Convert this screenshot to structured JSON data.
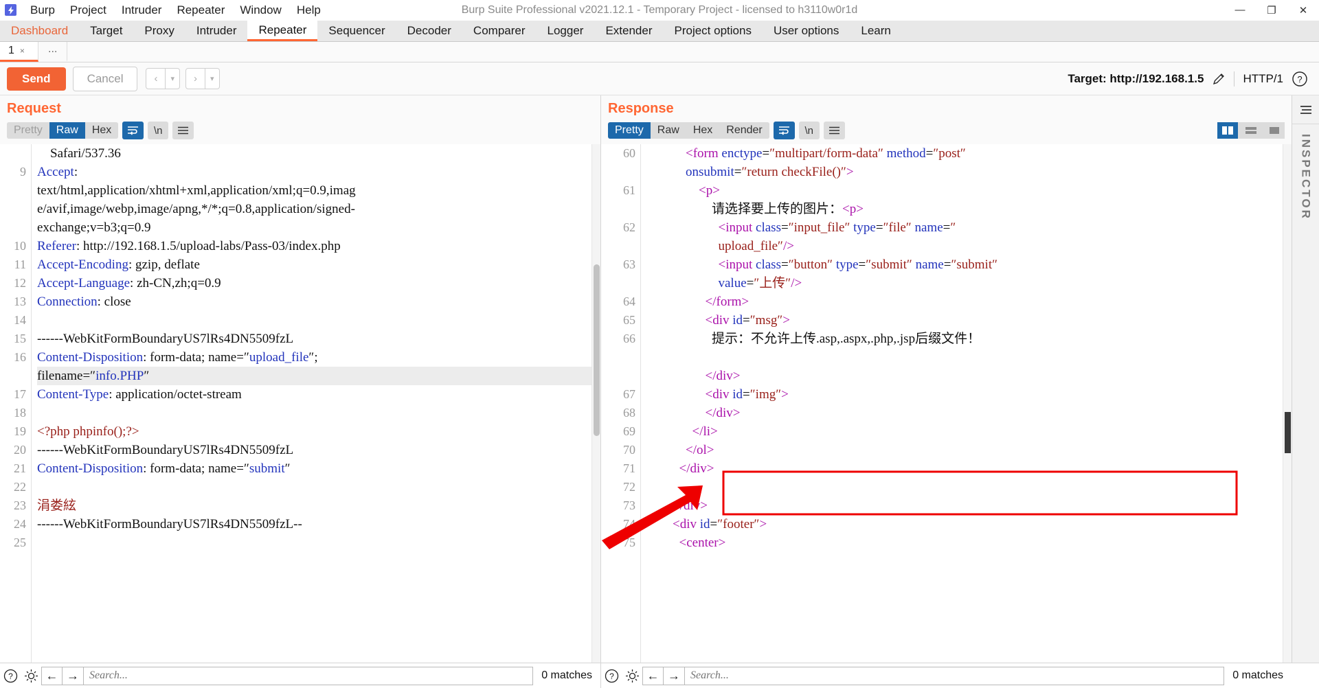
{
  "window": {
    "title": "Burp Suite Professional v2021.12.1 - Temporary Project - licensed to h3110w0r1d",
    "logo_glyph": "⚡",
    "minimize": "—",
    "maximize": "❐",
    "close": "✕"
  },
  "menubar": {
    "items": [
      "Burp",
      "Project",
      "Intruder",
      "Repeater",
      "Window",
      "Help"
    ]
  },
  "main_tabs": {
    "items": [
      "Dashboard",
      "Target",
      "Proxy",
      "Intruder",
      "Repeater",
      "Sequencer",
      "Decoder",
      "Comparer",
      "Logger",
      "Extender",
      "Project options",
      "User options",
      "Learn"
    ],
    "active": "Repeater",
    "accent": "#ff6633"
  },
  "repeater_tabs": {
    "items": [
      {
        "label": "1",
        "close": "×"
      }
    ],
    "add_label": "..."
  },
  "toolbar": {
    "send_label": "Send",
    "cancel_label": "Cancel",
    "back_arrow": "‹",
    "forward_arrow": "›",
    "dropdown_caret": "▾",
    "target_label": "Target: http://192.168.1.5",
    "edit_icon": "pencil-icon",
    "http_version": "HTTP/1",
    "help_icon": "?"
  },
  "request": {
    "title": "Request",
    "view_buttons": [
      "Pretty",
      "Raw",
      "Hex"
    ],
    "active_view": "Raw",
    "disabled_view": "Pretty",
    "wrap_icon_on": true,
    "newline_label": "\\n",
    "menu_icon": "☰",
    "lines": [
      {
        "num": "",
        "segs": [
          {
            "t": "    Safari/537.36",
            "c": "k-black"
          }
        ]
      },
      {
        "num": "9",
        "segs": [
          {
            "t": "Accept",
            "c": "k-blue"
          },
          {
            "t": ":",
            "c": "k-black"
          }
        ]
      },
      {
        "num": "",
        "segs": [
          {
            "t": "text/html,application/xhtml+xml,application/xml;q=0.9,imag",
            "c": "k-black"
          }
        ]
      },
      {
        "num": "",
        "segs": [
          {
            "t": "e/avif,image/webp,image/apng,*/*;q=0.8,application/signed-",
            "c": "k-black"
          }
        ]
      },
      {
        "num": "",
        "segs": [
          {
            "t": "exchange;v=b3;q=0.9",
            "c": "k-black"
          }
        ]
      },
      {
        "num": "10",
        "segs": [
          {
            "t": "Referer",
            "c": "k-blue"
          },
          {
            "t": ": http://192.168.1.5/upload-labs/Pass-03/index.php",
            "c": "k-black"
          }
        ]
      },
      {
        "num": "11",
        "segs": [
          {
            "t": "Accept-Encoding",
            "c": "k-blue"
          },
          {
            "t": ": gzip, deflate",
            "c": "k-black"
          }
        ]
      },
      {
        "num": "12",
        "segs": [
          {
            "t": "Accept-Language",
            "c": "k-blue"
          },
          {
            "t": ": zh-CN,zh;q=0.9",
            "c": "k-black"
          }
        ]
      },
      {
        "num": "13",
        "segs": [
          {
            "t": "Connection",
            "c": "k-blue"
          },
          {
            "t": ": close",
            "c": "k-black"
          }
        ]
      },
      {
        "num": "14",
        "segs": [
          {
            "t": "",
            "c": "k-black"
          }
        ]
      },
      {
        "num": "15",
        "segs": [
          {
            "t": "------WebKitFormBoundaryUS7lRs4DN5509fzL",
            "c": "k-black"
          }
        ]
      },
      {
        "num": "16",
        "segs": [
          {
            "t": "Content-Disposition",
            "c": "k-blue"
          },
          {
            "t": ": form-data; name=″",
            "c": "k-black"
          },
          {
            "t": "upload_file",
            "c": "k-blue"
          },
          {
            "t": "″;",
            "c": "k-black"
          }
        ]
      },
      {
        "num": "",
        "hl": true,
        "segs": [
          {
            "t": "filename=″",
            "c": "k-black"
          },
          {
            "t": "info.PHP",
            "c": "k-blue"
          },
          {
            "t": "″",
            "c": "k-black"
          }
        ]
      },
      {
        "num": "17",
        "segs": [
          {
            "t": "Content-Type",
            "c": "k-blue"
          },
          {
            "t": ": application/octet-stream",
            "c": "k-black"
          }
        ]
      },
      {
        "num": "18",
        "segs": [
          {
            "t": "",
            "c": "k-black"
          }
        ]
      },
      {
        "num": "19",
        "segs": [
          {
            "t": "<?php phpinfo();?>",
            "c": "k-darkred"
          }
        ]
      },
      {
        "num": "20",
        "segs": [
          {
            "t": "------WebKitFormBoundaryUS7lRs4DN5509fzL",
            "c": "k-black"
          }
        ]
      },
      {
        "num": "21",
        "segs": [
          {
            "t": "Content-Disposition",
            "c": "k-blue"
          },
          {
            "t": ": form-data; name=″",
            "c": "k-black"
          },
          {
            "t": "submit",
            "c": "k-blue"
          },
          {
            "t": "″",
            "c": "k-black"
          }
        ]
      },
      {
        "num": "22",
        "segs": [
          {
            "t": "",
            "c": "k-black"
          }
        ]
      },
      {
        "num": "23",
        "segs": [
          {
            "t": "涓娄絃",
            "c": "k-darkred"
          }
        ]
      },
      {
        "num": "24",
        "segs": [
          {
            "t": "------WebKitFormBoundaryUS7lRs4DN5509fzL--",
            "c": "k-black"
          }
        ]
      },
      {
        "num": "25",
        "segs": [
          {
            "t": "",
            "c": "k-black"
          }
        ]
      }
    ]
  },
  "response": {
    "title": "Response",
    "view_buttons": [
      "Pretty",
      "Raw",
      "Hex",
      "Render"
    ],
    "active_view": "Pretty",
    "wrap_icon_on": true,
    "newline_label": "\\n",
    "menu_icon": "☰",
    "layout_modes": [
      "split-vertical",
      "split-horizontal",
      "single"
    ],
    "active_layout": "split-vertical",
    "lines": [
      {
        "num": "60",
        "indent": 6,
        "segs": [
          {
            "t": "<",
            "c": "k-purple"
          },
          {
            "t": "form",
            "c": "k-purple"
          },
          {
            "t": " ",
            "c": "k-black"
          },
          {
            "t": "enctype",
            "c": "k-blue"
          },
          {
            "t": "=",
            "c": "k-black"
          },
          {
            "t": "″multipart/form-data″",
            "c": "k-darkred"
          },
          {
            "t": " ",
            "c": "k-black"
          },
          {
            "t": "method",
            "c": "k-blue"
          },
          {
            "t": "=",
            "c": "k-black"
          },
          {
            "t": "″post″",
            "c": "k-darkred"
          }
        ]
      },
      {
        "num": "",
        "indent": 6,
        "segs": [
          {
            "t": "onsubmit",
            "c": "k-blue"
          },
          {
            "t": "=",
            "c": "k-black"
          },
          {
            "t": "″return checkFile()″",
            "c": "k-darkred"
          },
          {
            "t": ">",
            "c": "k-purple"
          }
        ]
      },
      {
        "num": "61",
        "indent": 8,
        "segs": [
          {
            "t": "<p>",
            "c": "k-purple"
          }
        ]
      },
      {
        "num": "",
        "indent": 10,
        "segs": [
          {
            "t": "请选择要上传的图片：",
            "c": "k-black"
          },
          {
            "t": "<p>",
            "c": "k-purple"
          }
        ]
      },
      {
        "num": "62",
        "indent": 11,
        "segs": [
          {
            "t": "<",
            "c": "k-purple"
          },
          {
            "t": "input",
            "c": "k-purple"
          },
          {
            "t": " ",
            "c": "k-black"
          },
          {
            "t": "class",
            "c": "k-blue"
          },
          {
            "t": "=",
            "c": "k-black"
          },
          {
            "t": "″input_file″",
            "c": "k-darkred"
          },
          {
            "t": " ",
            "c": "k-black"
          },
          {
            "t": "type",
            "c": "k-blue"
          },
          {
            "t": "=",
            "c": "k-black"
          },
          {
            "t": "″file″",
            "c": "k-darkred"
          },
          {
            "t": " ",
            "c": "k-black"
          },
          {
            "t": "name",
            "c": "k-blue"
          },
          {
            "t": "=",
            "c": "k-black"
          },
          {
            "t": "″",
            "c": "k-darkred"
          }
        ]
      },
      {
        "num": "",
        "indent": 11,
        "segs": [
          {
            "t": "upload_file″",
            "c": "k-darkred"
          },
          {
            "t": "/>",
            "c": "k-purple"
          }
        ]
      },
      {
        "num": "63",
        "indent": 11,
        "segs": [
          {
            "t": "<",
            "c": "k-purple"
          },
          {
            "t": "input",
            "c": "k-purple"
          },
          {
            "t": " ",
            "c": "k-black"
          },
          {
            "t": "class",
            "c": "k-blue"
          },
          {
            "t": "=",
            "c": "k-black"
          },
          {
            "t": "″button″",
            "c": "k-darkred"
          },
          {
            "t": " ",
            "c": "k-black"
          },
          {
            "t": "type",
            "c": "k-blue"
          },
          {
            "t": "=",
            "c": "k-black"
          },
          {
            "t": "″submit″",
            "c": "k-darkred"
          },
          {
            "t": " ",
            "c": "k-black"
          },
          {
            "t": "name",
            "c": "k-blue"
          },
          {
            "t": "=",
            "c": "k-black"
          },
          {
            "t": "″submit″",
            "c": "k-darkred"
          }
        ]
      },
      {
        "num": "",
        "indent": 11,
        "segs": [
          {
            "t": "value",
            "c": "k-blue"
          },
          {
            "t": "=",
            "c": "k-black"
          },
          {
            "t": "″上传″",
            "c": "k-darkred"
          },
          {
            "t": "/>",
            "c": "k-purple"
          }
        ]
      },
      {
        "num": "64",
        "indent": 9,
        "segs": [
          {
            "t": "</form>",
            "c": "k-purple"
          }
        ]
      },
      {
        "num": "65",
        "indent": 9,
        "segs": [
          {
            "t": "<",
            "c": "k-purple"
          },
          {
            "t": "div",
            "c": "k-purple"
          },
          {
            "t": " ",
            "c": "k-black"
          },
          {
            "t": "id",
            "c": "k-blue"
          },
          {
            "t": "=",
            "c": "k-black"
          },
          {
            "t": "″msg″",
            "c": "k-darkred"
          },
          {
            "t": ">",
            "c": "k-purple"
          }
        ]
      },
      {
        "num": "66",
        "indent": 10,
        "segs": [
          {
            "t": "提示：不允许上传.asp,.aspx,.php,.jsp后缀文件！",
            "c": "k-black"
          }
        ]
      },
      {
        "num": "",
        "indent": 10,
        "segs": [
          {
            "t": "",
            "c": "k-black"
          }
        ]
      },
      {
        "num": "",
        "indent": 9,
        "segs": [
          {
            "t": "</div>",
            "c": "k-purple"
          }
        ]
      },
      {
        "num": "67",
        "indent": 9,
        "segs": [
          {
            "t": "<",
            "c": "k-purple"
          },
          {
            "t": "div",
            "c": "k-purple"
          },
          {
            "t": " ",
            "c": "k-black"
          },
          {
            "t": "id",
            "c": "k-blue"
          },
          {
            "t": "=",
            "c": "k-black"
          },
          {
            "t": "″img″",
            "c": "k-darkred"
          },
          {
            "t": ">",
            "c": "k-purple"
          }
        ]
      },
      {
        "num": "68",
        "indent": 9,
        "segs": [
          {
            "t": "</div>",
            "c": "k-purple"
          }
        ]
      },
      {
        "num": "69",
        "indent": 7,
        "segs": [
          {
            "t": "</li>",
            "c": "k-purple"
          }
        ]
      },
      {
        "num": "70",
        "indent": 6,
        "segs": [
          {
            "t": "</ol>",
            "c": "k-purple"
          }
        ]
      },
      {
        "num": "71",
        "indent": 5,
        "segs": [
          {
            "t": "</div>",
            "c": "k-purple"
          }
        ]
      },
      {
        "num": "72",
        "indent": 0,
        "segs": [
          {
            "t": "",
            "c": "k-black"
          }
        ]
      },
      {
        "num": "73",
        "indent": 4,
        "segs": [
          {
            "t": "</div>",
            "c": "k-purple"
          }
        ]
      },
      {
        "num": "74",
        "indent": 4,
        "segs": [
          {
            "t": "<",
            "c": "k-purple"
          },
          {
            "t": "div",
            "c": "k-purple"
          },
          {
            "t": " ",
            "c": "k-black"
          },
          {
            "t": "id",
            "c": "k-blue"
          },
          {
            "t": "=",
            "c": "k-black"
          },
          {
            "t": "″footer″",
            "c": "k-darkred"
          },
          {
            "t": ">",
            "c": "k-purple"
          }
        ]
      },
      {
        "num": "75",
        "indent": 5,
        "segs": [
          {
            "t": "<center>",
            "c": "k-purple"
          }
        ]
      }
    ],
    "annotation": {
      "box_color": "#ee0000",
      "arrow_color": "#ee0000"
    }
  },
  "inspector": {
    "label": "INSPECTOR",
    "menu_icon": "☰"
  },
  "footer": {
    "help_icon": "?",
    "settings_icon": "gear-icon",
    "prev_icon": "←",
    "next_icon": "→",
    "search_placeholder": "Search...",
    "search_value": "",
    "left_matches": "0 matches",
    "right_matches": "0 matches"
  }
}
